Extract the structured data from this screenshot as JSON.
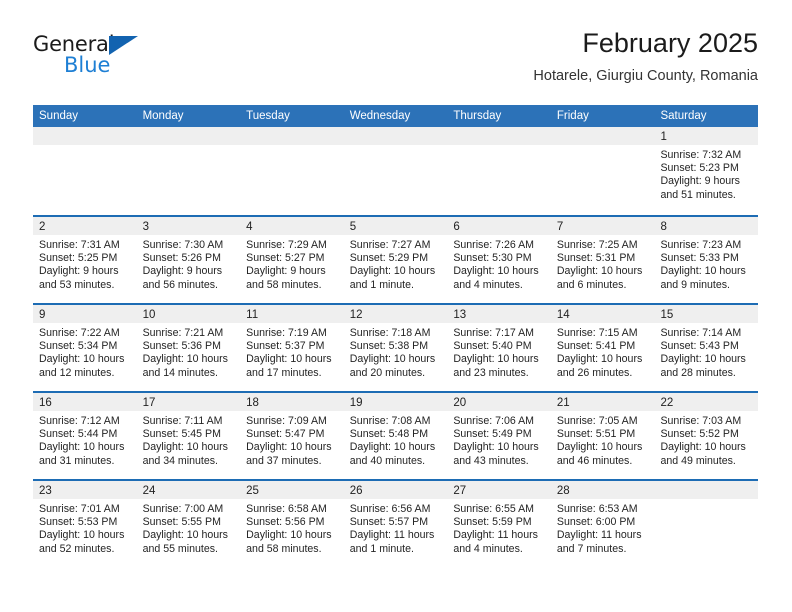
{
  "brand": {
    "name_top": "General",
    "name_bottom": "Blue",
    "triangle_color": "#1263b0",
    "blue_color": "#1e7fd4"
  },
  "header": {
    "title": "February 2025",
    "subtitle": "Hotarele, Giurgiu County, Romania",
    "accent_color": "#2c72b8",
    "row_divider_color": "#1d6cb4",
    "daynum_band_color": "#efefef"
  },
  "calendar": {
    "weekday_labels": [
      "Sunday",
      "Monday",
      "Tuesday",
      "Wednesday",
      "Thursday",
      "Friday",
      "Saturday"
    ],
    "weeks": [
      [
        {
          "day": "",
          "lines": []
        },
        {
          "day": "",
          "lines": []
        },
        {
          "day": "",
          "lines": []
        },
        {
          "day": "",
          "lines": []
        },
        {
          "day": "",
          "lines": []
        },
        {
          "day": "",
          "lines": []
        },
        {
          "day": "1",
          "lines": [
            "Sunrise: 7:32 AM",
            "Sunset: 5:23 PM",
            "Daylight: 9 hours",
            "and 51 minutes."
          ]
        }
      ],
      [
        {
          "day": "2",
          "lines": [
            "Sunrise: 7:31 AM",
            "Sunset: 5:25 PM",
            "Daylight: 9 hours",
            "and 53 minutes."
          ]
        },
        {
          "day": "3",
          "lines": [
            "Sunrise: 7:30 AM",
            "Sunset: 5:26 PM",
            "Daylight: 9 hours",
            "and 56 minutes."
          ]
        },
        {
          "day": "4",
          "lines": [
            "Sunrise: 7:29 AM",
            "Sunset: 5:27 PM",
            "Daylight: 9 hours",
            "and 58 minutes."
          ]
        },
        {
          "day": "5",
          "lines": [
            "Sunrise: 7:27 AM",
            "Sunset: 5:29 PM",
            "Daylight: 10 hours",
            "and 1 minute."
          ]
        },
        {
          "day": "6",
          "lines": [
            "Sunrise: 7:26 AM",
            "Sunset: 5:30 PM",
            "Daylight: 10 hours",
            "and 4 minutes."
          ]
        },
        {
          "day": "7",
          "lines": [
            "Sunrise: 7:25 AM",
            "Sunset: 5:31 PM",
            "Daylight: 10 hours",
            "and 6 minutes."
          ]
        },
        {
          "day": "8",
          "lines": [
            "Sunrise: 7:23 AM",
            "Sunset: 5:33 PM",
            "Daylight: 10 hours",
            "and 9 minutes."
          ]
        }
      ],
      [
        {
          "day": "9",
          "lines": [
            "Sunrise: 7:22 AM",
            "Sunset: 5:34 PM",
            "Daylight: 10 hours",
            "and 12 minutes."
          ]
        },
        {
          "day": "10",
          "lines": [
            "Sunrise: 7:21 AM",
            "Sunset: 5:36 PM",
            "Daylight: 10 hours",
            "and 14 minutes."
          ]
        },
        {
          "day": "11",
          "lines": [
            "Sunrise: 7:19 AM",
            "Sunset: 5:37 PM",
            "Daylight: 10 hours",
            "and 17 minutes."
          ]
        },
        {
          "day": "12",
          "lines": [
            "Sunrise: 7:18 AM",
            "Sunset: 5:38 PM",
            "Daylight: 10 hours",
            "and 20 minutes."
          ]
        },
        {
          "day": "13",
          "lines": [
            "Sunrise: 7:17 AM",
            "Sunset: 5:40 PM",
            "Daylight: 10 hours",
            "and 23 minutes."
          ]
        },
        {
          "day": "14",
          "lines": [
            "Sunrise: 7:15 AM",
            "Sunset: 5:41 PM",
            "Daylight: 10 hours",
            "and 26 minutes."
          ]
        },
        {
          "day": "15",
          "lines": [
            "Sunrise: 7:14 AM",
            "Sunset: 5:43 PM",
            "Daylight: 10 hours",
            "and 28 minutes."
          ]
        }
      ],
      [
        {
          "day": "16",
          "lines": [
            "Sunrise: 7:12 AM",
            "Sunset: 5:44 PM",
            "Daylight: 10 hours",
            "and 31 minutes."
          ]
        },
        {
          "day": "17",
          "lines": [
            "Sunrise: 7:11 AM",
            "Sunset: 5:45 PM",
            "Daylight: 10 hours",
            "and 34 minutes."
          ]
        },
        {
          "day": "18",
          "lines": [
            "Sunrise: 7:09 AM",
            "Sunset: 5:47 PM",
            "Daylight: 10 hours",
            "and 37 minutes."
          ]
        },
        {
          "day": "19",
          "lines": [
            "Sunrise: 7:08 AM",
            "Sunset: 5:48 PM",
            "Daylight: 10 hours",
            "and 40 minutes."
          ]
        },
        {
          "day": "20",
          "lines": [
            "Sunrise: 7:06 AM",
            "Sunset: 5:49 PM",
            "Daylight: 10 hours",
            "and 43 minutes."
          ]
        },
        {
          "day": "21",
          "lines": [
            "Sunrise: 7:05 AM",
            "Sunset: 5:51 PM",
            "Daylight: 10 hours",
            "and 46 minutes."
          ]
        },
        {
          "day": "22",
          "lines": [
            "Sunrise: 7:03 AM",
            "Sunset: 5:52 PM",
            "Daylight: 10 hours",
            "and 49 minutes."
          ]
        }
      ],
      [
        {
          "day": "23",
          "lines": [
            "Sunrise: 7:01 AM",
            "Sunset: 5:53 PM",
            "Daylight: 10 hours",
            "and 52 minutes."
          ]
        },
        {
          "day": "24",
          "lines": [
            "Sunrise: 7:00 AM",
            "Sunset: 5:55 PM",
            "Daylight: 10 hours",
            "and 55 minutes."
          ]
        },
        {
          "day": "25",
          "lines": [
            "Sunrise: 6:58 AM",
            "Sunset: 5:56 PM",
            "Daylight: 10 hours",
            "and 58 minutes."
          ]
        },
        {
          "day": "26",
          "lines": [
            "Sunrise: 6:56 AM",
            "Sunset: 5:57 PM",
            "Daylight: 11 hours",
            "and 1 minute."
          ]
        },
        {
          "day": "27",
          "lines": [
            "Sunrise: 6:55 AM",
            "Sunset: 5:59 PM",
            "Daylight: 11 hours",
            "and 4 minutes."
          ]
        },
        {
          "day": "28",
          "lines": [
            "Sunrise: 6:53 AM",
            "Sunset: 6:00 PM",
            "Daylight: 11 hours",
            "and 7 minutes."
          ]
        },
        {
          "day": "",
          "lines": []
        }
      ]
    ]
  }
}
